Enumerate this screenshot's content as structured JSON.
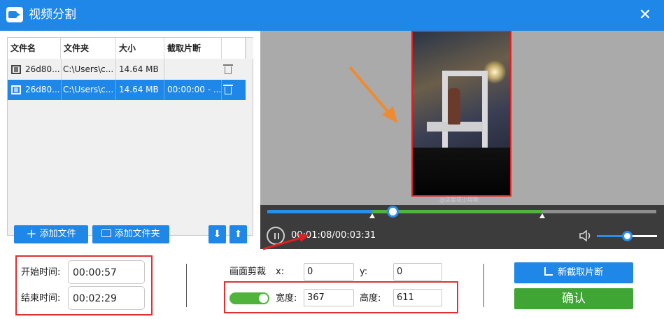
{
  "window": {
    "title": "视频分割",
    "close_label": "✕"
  },
  "file_list": {
    "columns": [
      "文件名",
      "文件夹",
      "大小",
      "截取片断"
    ],
    "rows": [
      {
        "name": "26d80...",
        "folder": "C:\\Users\\c...",
        "size": "14.64 MB",
        "clip": "",
        "selected": false
      },
      {
        "name": "26d80...",
        "folder": "C:\\Users\\c...",
        "size": "14.64 MB",
        "clip": "00:00:00 - ...",
        "selected": true
      }
    ]
  },
  "buttons": {
    "add_file": "添加文件",
    "add_folder": "添加文件夹",
    "move_down": "⬇",
    "move_up": "⬆",
    "new_clip": "新截取片断",
    "confirm": "确认"
  },
  "player": {
    "watermark": "@这里花小导呦",
    "time_display": "00:01:08/00:03:31",
    "progress": 0.322,
    "clip_start": 0.27,
    "clip_end": 0.706,
    "volume": 0.5
  },
  "clip_range": {
    "start_label": "开始时间:",
    "start_value": "00:00:57",
    "end_label": "结束时间:",
    "end_value": "00:02:29"
  },
  "crop": {
    "section_label": "画面剪裁",
    "x_label": "x:",
    "x_value": "0",
    "y_label": "y:",
    "y_value": "0",
    "width_label": "宽度:",
    "width_value": "367",
    "height_label": "高度:",
    "height_value": "611",
    "enabled": true
  },
  "colors": {
    "accent": "#1f87e8",
    "confirm": "#3fa635",
    "clip_track": "#4fb33c",
    "highlight_box": "#e03030",
    "arrow": "#f08a30"
  }
}
